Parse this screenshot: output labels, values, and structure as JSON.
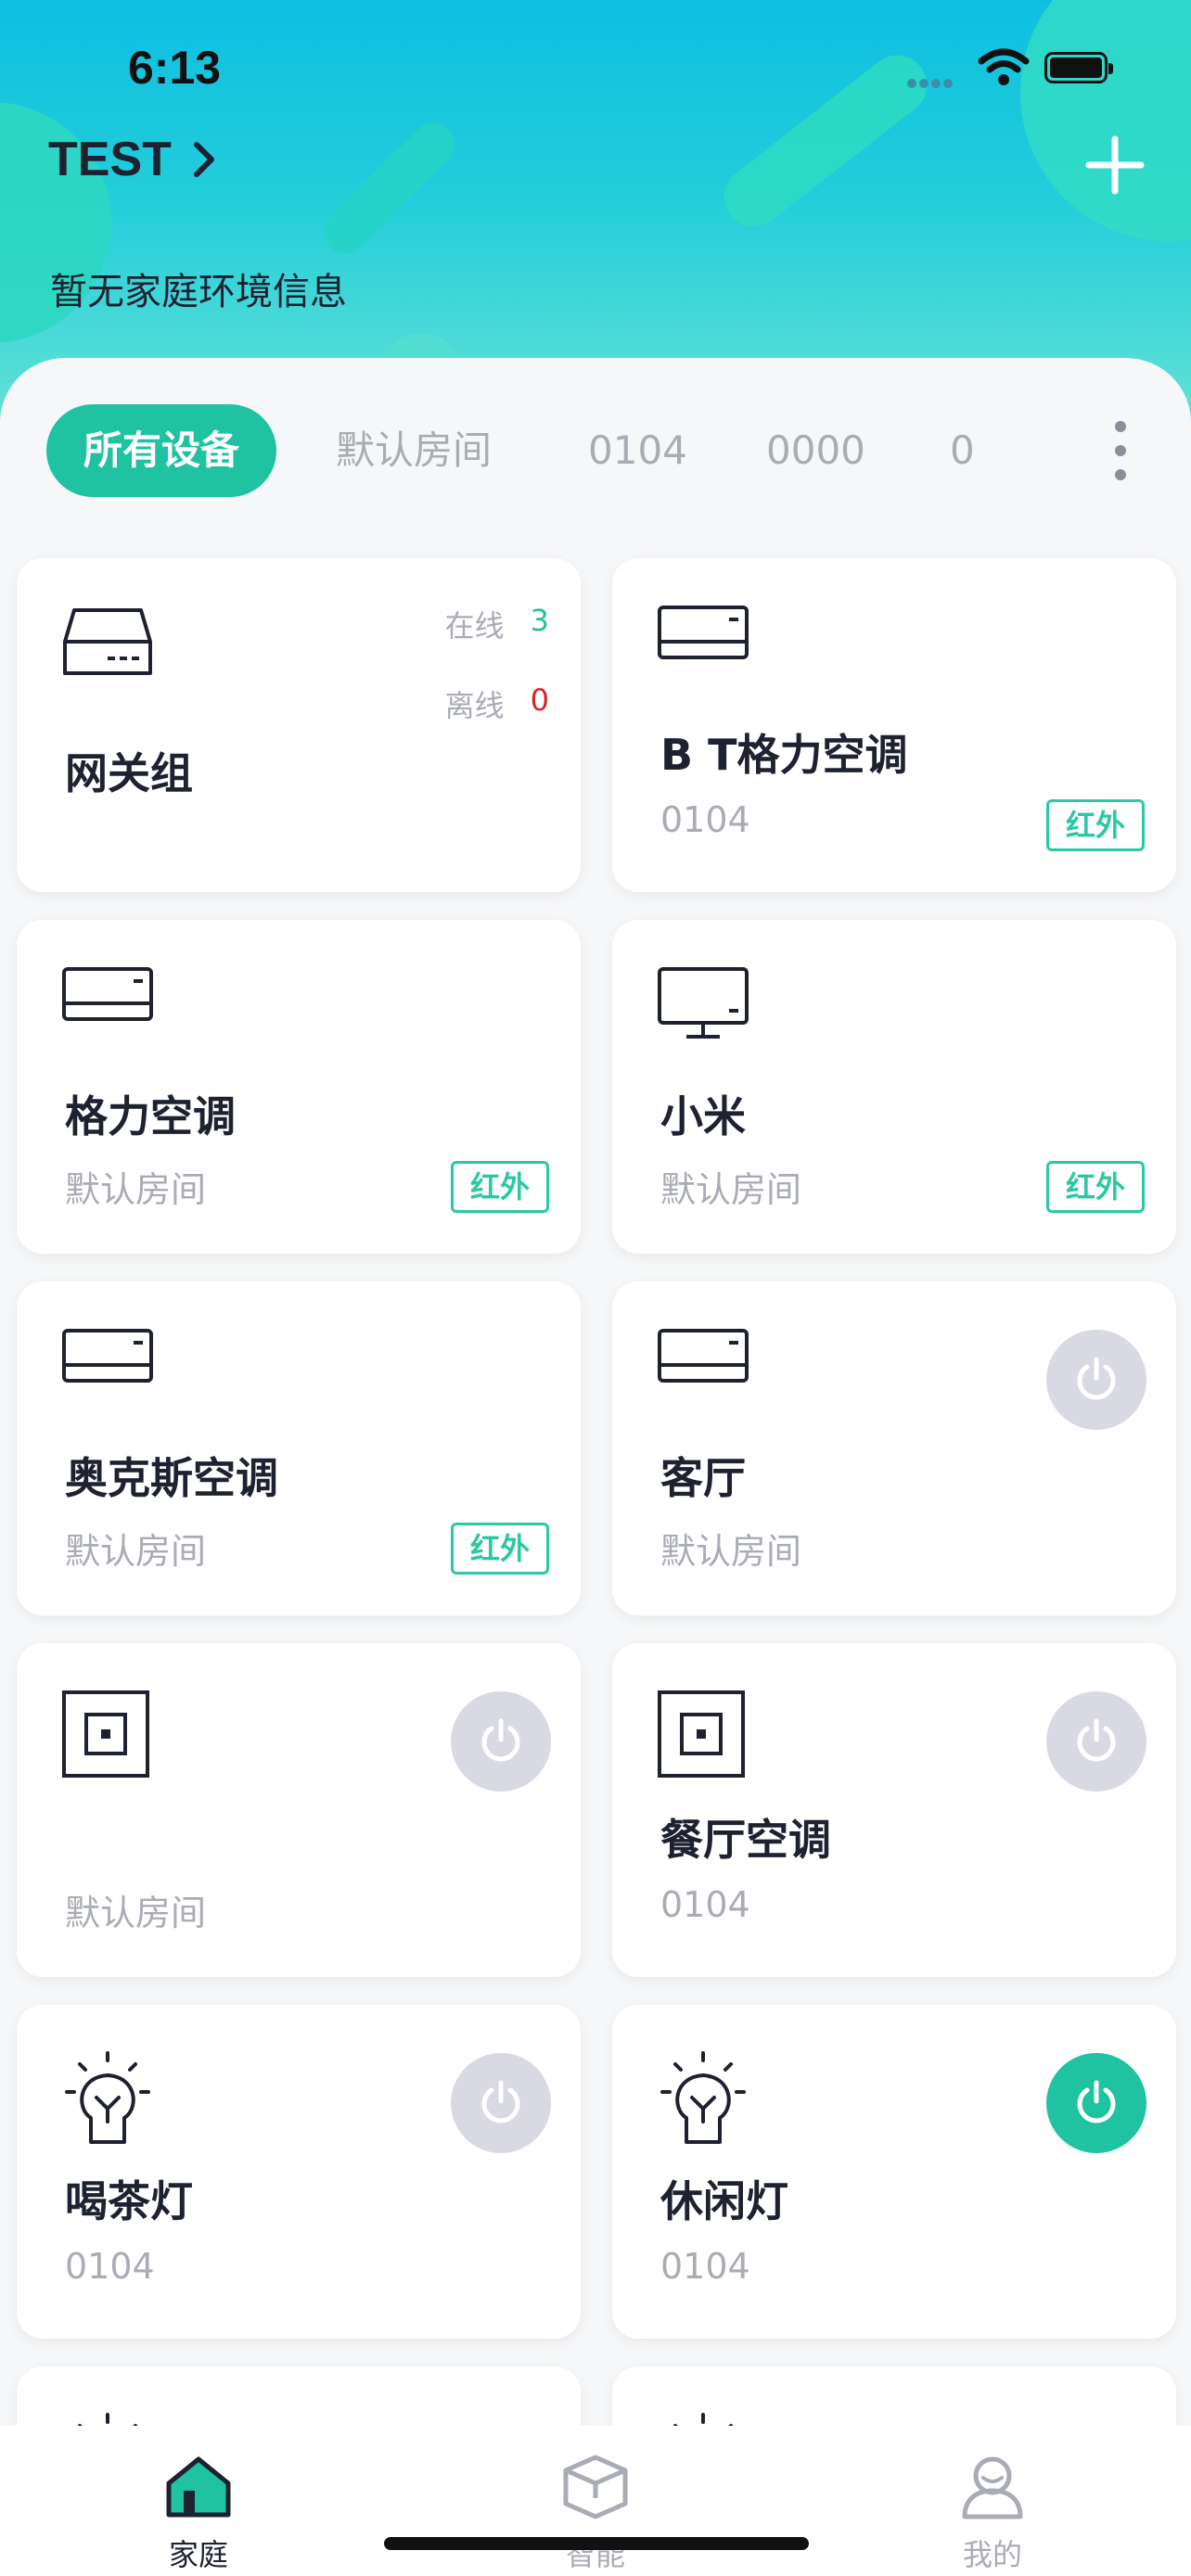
{
  "status_bar": {
    "time": "6:13"
  },
  "header": {
    "home_name": "TEST",
    "env_info": "暂无家庭环境信息"
  },
  "tabs": [
    {
      "label": "所有设备",
      "active": true
    },
    {
      "label": "默认房间",
      "active": false
    },
    {
      "label": "0104",
      "active": false
    },
    {
      "label": "0000",
      "active": false
    },
    {
      "label": "0",
      "active": false
    }
  ],
  "gateway": {
    "name": "网关组",
    "online_label": "在线",
    "online_count": "3",
    "offline_label": "离线",
    "offline_count": "0"
  },
  "devices": [
    {
      "name": "B T格力空调",
      "room": "0104",
      "badge": "红外",
      "icon": "air-conditioner-icon"
    },
    {
      "name": "格力空调",
      "room": "默认房间",
      "badge": "红外",
      "icon": "air-conditioner-icon"
    },
    {
      "name": "小米",
      "room": "默认房间",
      "badge": "红外",
      "icon": "tv-icon"
    },
    {
      "name": "奥克斯空调",
      "room": "默认房间",
      "badge": "红外",
      "icon": "air-conditioner-icon"
    },
    {
      "name": "客厅",
      "room": "默认房间",
      "power": "off",
      "icon": "air-conditioner-icon"
    },
    {
      "name": "",
      "room": "默认房间",
      "power": "off",
      "icon": "wall-switch-icon"
    },
    {
      "name": "餐厅空调",
      "room": "0104",
      "power": "off",
      "icon": "wall-switch-icon"
    },
    {
      "name": "喝茶灯",
      "room": "0104",
      "power": "off",
      "icon": "light-bulb-icon"
    },
    {
      "name": "休闲灯",
      "room": "0104",
      "power": "on",
      "icon": "light-bulb-icon"
    }
  ],
  "bottom_nav": [
    {
      "label": "家庭",
      "icon": "home-icon",
      "active": true
    },
    {
      "label": "智能",
      "icon": "cube-icon",
      "active": false
    },
    {
      "label": "我的",
      "icon": "person-icon",
      "active": false
    }
  ],
  "colors": {
    "accent": "#1fc3a1",
    "header_top": "#0ebfe1",
    "header_bottom": "#69e3d6",
    "text_primary": "#1d2130",
    "text_secondary": "#a9acb4",
    "offline": "#d9242b",
    "power_off": "#d8d9e3"
  }
}
